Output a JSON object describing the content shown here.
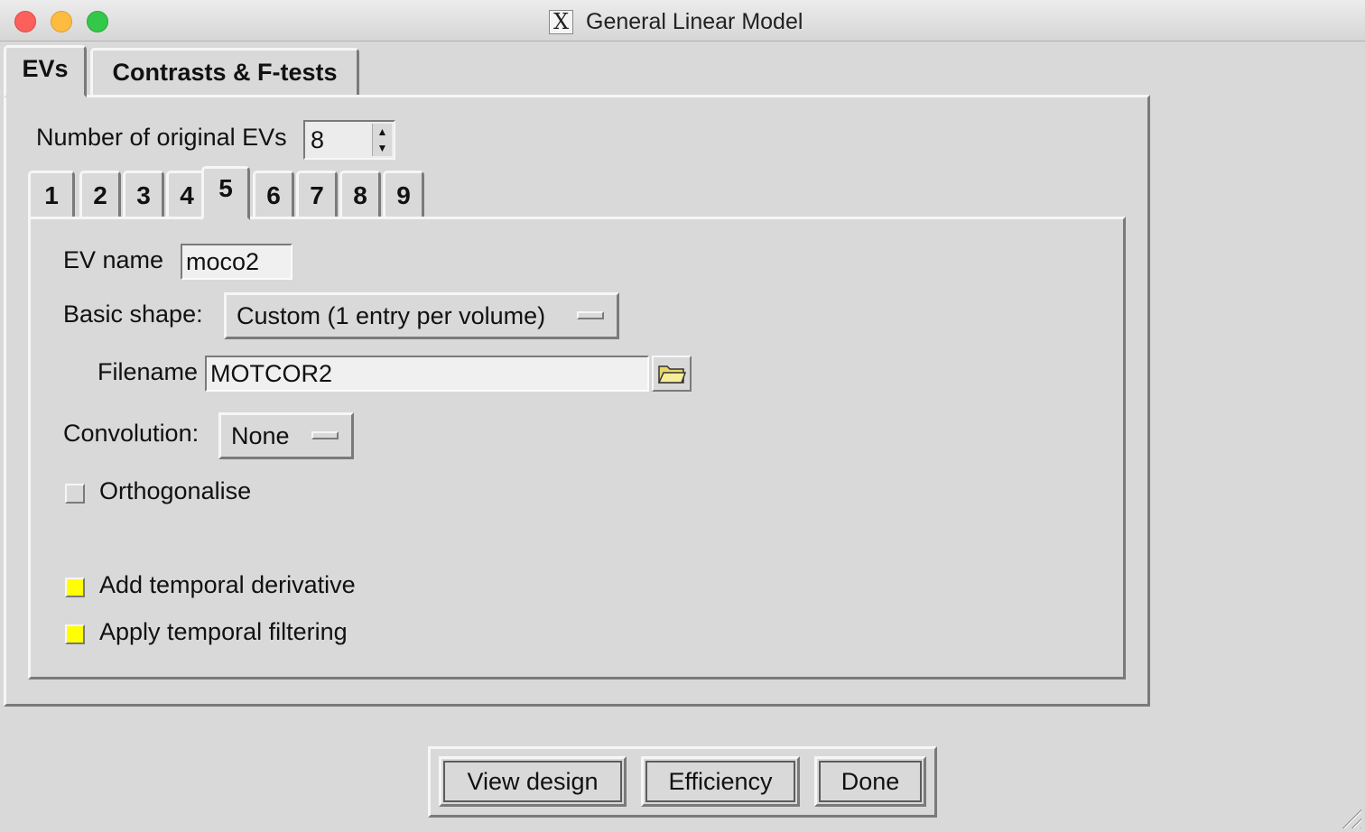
{
  "window": {
    "title": "General Linear Model",
    "logo_glyph": "X"
  },
  "outer_tabs": {
    "evs": "EVs",
    "contrasts": "Contrasts & F-tests"
  },
  "ev_count": {
    "label": "Number of original EVs",
    "value": "8"
  },
  "ev_tabs": [
    "1",
    "2",
    "3",
    "4",
    "5",
    "6",
    "7",
    "8",
    "9"
  ],
  "ev_tab_selected": "5",
  "ev": {
    "name_label": "EV name",
    "name_value": "moco2",
    "shape_label": "Basic shape:",
    "shape_value": "Custom (1 entry per volume)",
    "filename_label": "Filename",
    "filename_value": "MOTCOR2",
    "convolution_label": "Convolution:",
    "convolution_value": "None",
    "orthogonalise_label": "Orthogonalise",
    "orthogonalise_checked": false,
    "temporal_derivative_label": "Add temporal derivative",
    "temporal_derivative_checked": true,
    "temporal_filtering_label": "Apply temporal filtering",
    "temporal_filtering_checked": true
  },
  "buttons": {
    "view_design": "View design",
    "efficiency": "Efficiency",
    "done": "Done"
  },
  "colors": {
    "background": "#d9d9d9",
    "checkbox_on": "#ffff00",
    "close": "#fc605c",
    "minimize": "#fdbc40",
    "maximize": "#34c84a"
  }
}
